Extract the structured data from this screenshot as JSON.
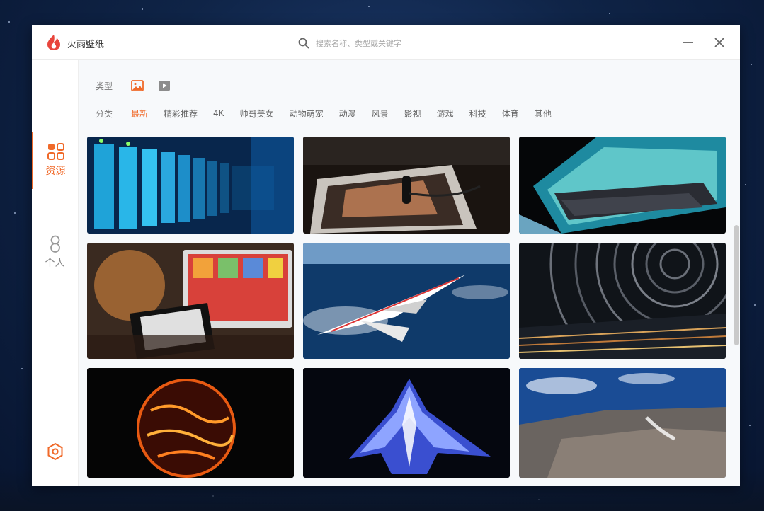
{
  "app": {
    "title": "火雨壁纸"
  },
  "search": {
    "placeholder": "搜索名称、类型或关键字"
  },
  "sidebar": {
    "items": [
      {
        "label": "资源",
        "icon": "grid-icon",
        "active": true
      },
      {
        "label": "个人",
        "icon": "user-icon",
        "active": false
      }
    ]
  },
  "filters": {
    "type_label": "类型",
    "types": [
      {
        "icon": "image-icon",
        "active": true
      },
      {
        "icon": "video-icon",
        "active": false
      }
    ],
    "category_label": "分类",
    "categories": [
      "最新",
      "精彩推荐",
      "4K",
      "帅哥美女",
      "动物萌宠",
      "动漫",
      "风景",
      "影视",
      "游戏",
      "科技",
      "体育",
      "其他"
    ],
    "active_category": "最新"
  },
  "colors": {
    "accent": "#f06a2a",
    "text_muted": "#666666"
  },
  "wallpapers": [
    {
      "icon": "server-rack-thumbnail"
    },
    {
      "icon": "tablet-earphones-thumbnail"
    },
    {
      "icon": "laptop-keyboard-thumbnail"
    },
    {
      "icon": "laptop-phone-thumbnail"
    },
    {
      "icon": "supersonic-jet-thumbnail"
    },
    {
      "icon": "star-trails-thumbnail"
    },
    {
      "icon": "sun-surface-thumbnail"
    },
    {
      "icon": "glowing-aircraft-thumbnail"
    },
    {
      "icon": "earth-clouds-thumbnail"
    }
  ]
}
